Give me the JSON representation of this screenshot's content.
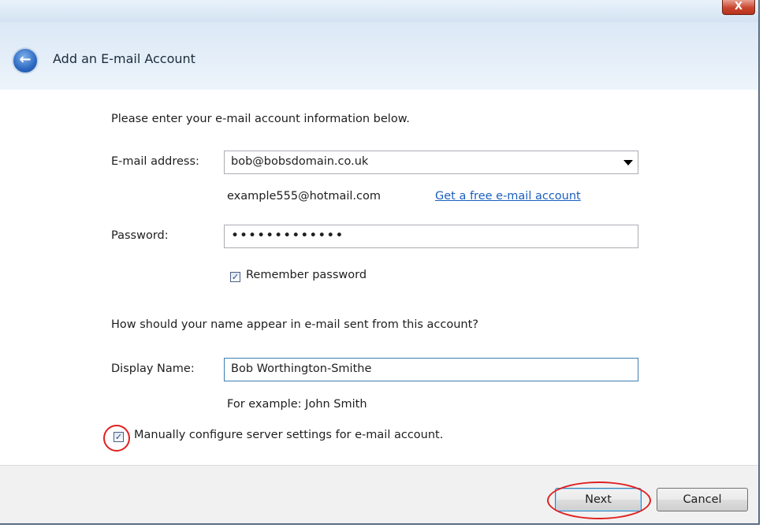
{
  "window": {
    "close_label": "X"
  },
  "header": {
    "title": "Add an E-mail Account"
  },
  "form": {
    "instructions": "Please enter your e-mail account information below.",
    "email": {
      "label": "E-mail address:",
      "value": "bob@bobsdomain.co.uk",
      "example": "example555@hotmail.com",
      "free_link": "Get a free e-mail account"
    },
    "password": {
      "label": "Password:",
      "masked_value": "•••••••••••••"
    },
    "remember_password": {
      "label": "Remember password",
      "checked": true
    },
    "name_question": "How should your name appear in e-mail sent from this account?",
    "display_name": {
      "label": "Display Name:",
      "value": "Bob Worthington-Smithe",
      "example": "For example: John Smith"
    },
    "manual_config": {
      "label": "Manually configure server settings for e-mail account.",
      "checked": true
    },
    "check_glyph": "✓"
  },
  "footer": {
    "next_label": "Next",
    "cancel_label": "Cancel"
  },
  "colors": {
    "highlight": "#e02020",
    "link": "#1a5fbf",
    "header_bg": "#dbe8f6"
  }
}
